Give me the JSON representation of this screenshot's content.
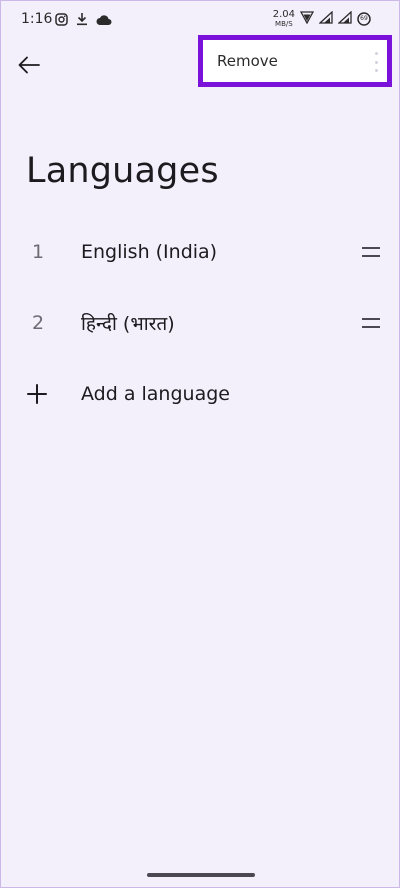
{
  "status_bar": {
    "time": "1:16",
    "net_speed_value": "2.04",
    "net_speed_unit": "MB/S",
    "left_icons": [
      "instagram-icon",
      "download-icon",
      "cloud-icon"
    ],
    "right_icons": [
      "wifi-signal-icon",
      "cell-signal-icon",
      "cell-signal-icon",
      "battery-icon"
    ],
    "battery_level": "69"
  },
  "top_bar": {
    "back_icon": "arrow-left-icon",
    "menu": {
      "remove_label": "Remove",
      "overflow_icon": "more-vertical-icon"
    }
  },
  "page": {
    "title": "Languages"
  },
  "languages": [
    {
      "index": "1",
      "name": "English (India)"
    },
    {
      "index": "2",
      "name": "हिन्दी (भारत)"
    }
  ],
  "add_language": {
    "label": "Add a language",
    "icon": "plus-icon"
  },
  "colors": {
    "background": "#f4f0fb",
    "highlight_border": "#7a12d9",
    "text_primary": "#1c1b1f",
    "text_secondary": "#6c6a72"
  }
}
